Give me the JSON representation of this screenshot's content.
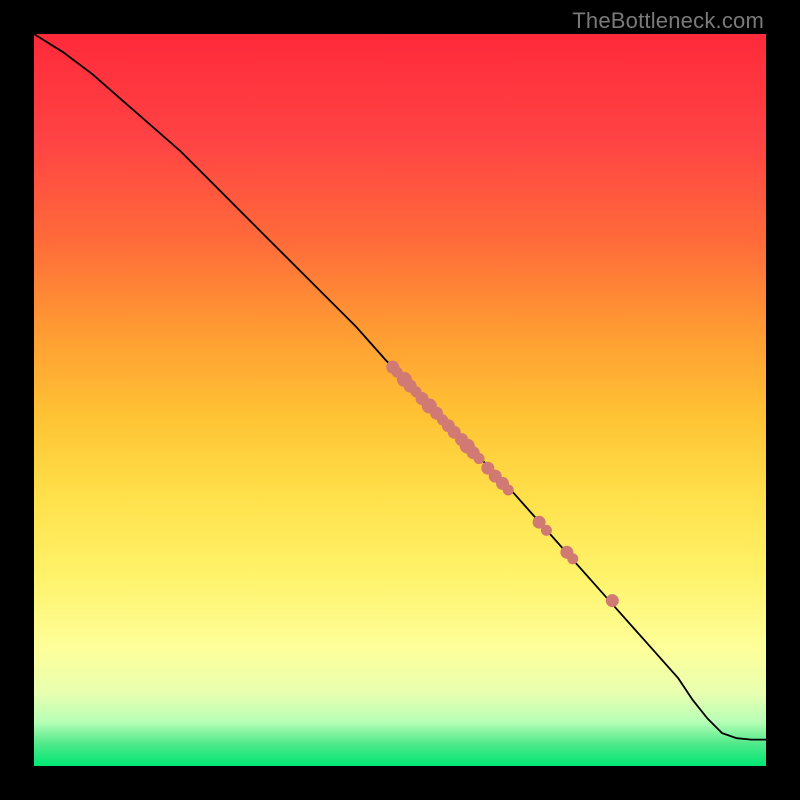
{
  "watermark": "TheBottleneck.com",
  "colors": {
    "page_bg": "#000000",
    "curve": "#000000",
    "dot_fill": "#d07a73"
  },
  "chart_data": {
    "type": "line",
    "title": "",
    "xlabel": "",
    "ylabel": "",
    "xlim": [
      0,
      100
    ],
    "ylim": [
      0,
      100
    ],
    "grid": false,
    "legend": false,
    "curve": {
      "x": [
        0,
        4,
        8,
        12,
        16,
        20,
        24,
        28,
        32,
        36,
        40,
        44,
        48,
        52,
        56,
        60,
        64,
        68,
        72,
        76,
        80,
        84,
        88,
        90,
        92,
        94,
        96,
        98,
        100
      ],
      "y": [
        100,
        97.5,
        94.5,
        91,
        87.5,
        84,
        80,
        76,
        72,
        68,
        64,
        60,
        55.5,
        51.5,
        47,
        43,
        39,
        34.5,
        30,
        25.5,
        21,
        16.5,
        12,
        9,
        6.5,
        4.5,
        3.8,
        3.6,
        3.6
      ]
    },
    "points": {
      "x": [
        49.0,
        49.6,
        50.6,
        51.4,
        52.2,
        53.0,
        54.0,
        55.0,
        55.8,
        56.6,
        57.4,
        58.4,
        59.2,
        60.0,
        60.8,
        62.0,
        63.0,
        64.0,
        64.8,
        69.0,
        70.0,
        72.8,
        73.6,
        79.0
      ],
      "y": [
        54.5,
        53.8,
        52.8,
        51.9,
        51.1,
        50.2,
        49.2,
        48.2,
        47.3,
        46.5,
        45.6,
        44.6,
        43.7,
        42.8,
        42.0,
        40.7,
        39.6,
        38.6,
        37.7,
        33.3,
        32.2,
        29.2,
        28.3,
        22.6
      ],
      "r": [
        6,
        5,
        7,
        6,
        5,
        6,
        7,
        6,
        5,
        6,
        6,
        6,
        7,
        6,
        5,
        6,
        6,
        6,
        5,
        6,
        5,
        6,
        5,
        6
      ]
    }
  }
}
